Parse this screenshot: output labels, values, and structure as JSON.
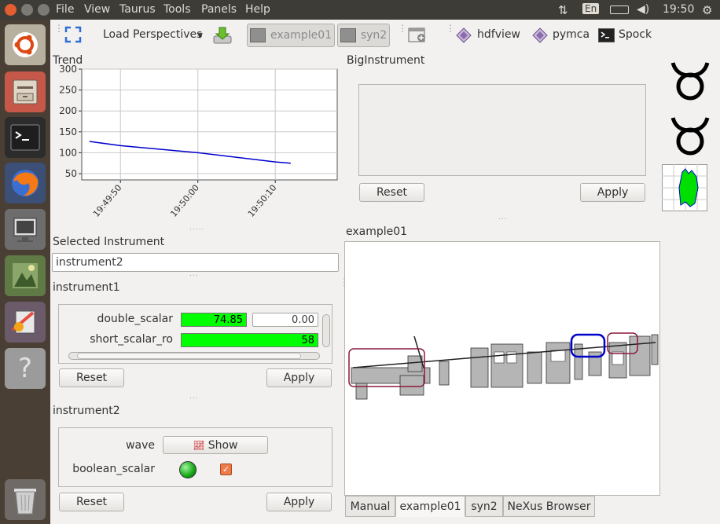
{
  "window": {
    "close": "close",
    "minimize": "minimize",
    "maximize": "maximize"
  },
  "menu": [
    "File",
    "View",
    "Taurus",
    "Tools",
    "Panels",
    "Help"
  ],
  "tray": {
    "keyboard": "En",
    "time": "19:50"
  },
  "toolbar": {
    "load_perspectives": "Load Perspectives",
    "example01": "example01",
    "syn2": "syn2",
    "hdfview": "hdfview",
    "pymca": "pymca",
    "spock": "Spock"
  },
  "trend": {
    "title": "Trend",
    "chart_data": {
      "type": "line",
      "x": [
        "19:49:46",
        "19:49:50",
        "19:50:00",
        "19:50:10",
        "19:50:12"
      ],
      "y": [
        127,
        117,
        100,
        78,
        75
      ],
      "xticks": [
        "19:49:50",
        "19:50:00",
        "19:50:10"
      ],
      "yticks": [
        50,
        100,
        150,
        200,
        250,
        300
      ],
      "ylim": [
        35,
        300
      ],
      "color": "#0000cc",
      "grid": true
    }
  },
  "big_instrument": {
    "title": "BigInstrument",
    "reset": "Reset",
    "apply": "Apply"
  },
  "selected_instrument": {
    "title": "Selected Instrument",
    "value": "instrument2"
  },
  "instrument1": {
    "title": "instrument1",
    "rows": [
      {
        "label": "double_scalar",
        "value": "74.85",
        "write": "0.00"
      },
      {
        "label": "short_scalar_ro",
        "value": "58"
      }
    ],
    "reset": "Reset",
    "apply": "Apply"
  },
  "instrument2": {
    "title": "instrument2",
    "wave_label": "wave",
    "show": "Show",
    "boolean_label": "boolean_scalar",
    "reset": "Reset",
    "apply": "Apply"
  },
  "example01": {
    "title": "example01"
  },
  "tabs": [
    "Manual",
    "example01",
    "syn2",
    "NeXus Browser"
  ],
  "colors": {
    "value_bg": "#00ff00",
    "accent": "#e95420",
    "trend_line": "#0000cc"
  }
}
